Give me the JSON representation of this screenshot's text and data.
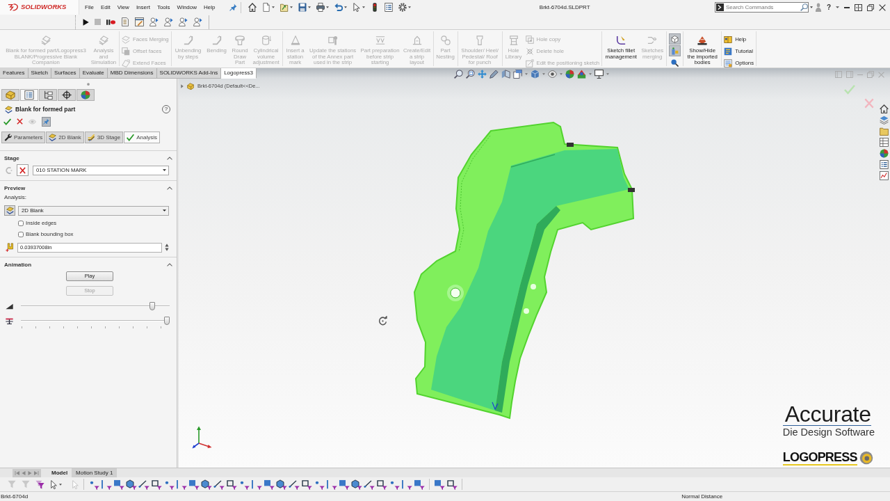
{
  "title_bar": {
    "logo": "SOLIDWORKS",
    "menus": [
      "File",
      "Edit",
      "View",
      "Insert",
      "Tools",
      "Window",
      "Help"
    ],
    "document_title": "Brkt-6704d.SLDPRT",
    "search": {
      "placeholder": "Search Commands"
    },
    "help_button": "?"
  },
  "ribbon": {
    "groups": [
      {
        "commands": [
          {
            "kind": "large",
            "label": "Blank for formed part/Logopress3 BLANK/Progressive Blank Companion",
            "disabled": true
          },
          {
            "kind": "large",
            "label": "Analysis and Simulation",
            "disabled": true
          }
        ]
      },
      {
        "commands": [
          {
            "kind": "small",
            "label": "Faces Merging",
            "disabled": true
          },
          {
            "kind": "small",
            "label": "Offset faces",
            "disabled": true
          },
          {
            "kind": "small",
            "label": "Extend Faces",
            "disabled": true
          }
        ]
      },
      {
        "commands": [
          {
            "kind": "large",
            "label": "Unbending by steps",
            "disabled": true
          },
          {
            "kind": "large",
            "label": "Bending",
            "disabled": true
          },
          {
            "kind": "large",
            "label": "Round Draw Part",
            "disabled": true
          },
          {
            "kind": "large",
            "label": "Cylindrical volume adjustment",
            "disabled": true
          }
        ]
      },
      {
        "commands": [
          {
            "kind": "large",
            "label": "Insert a station mark",
            "disabled": true
          },
          {
            "kind": "large",
            "label": "Update the stations of the Annex part used in the strip",
            "disabled": true
          },
          {
            "kind": "large",
            "label": "Part preparation before strip starting",
            "disabled": true
          },
          {
            "kind": "large",
            "label": "Create/Edit a strip layout",
            "disabled": true
          }
        ]
      },
      {
        "commands": [
          {
            "kind": "large",
            "label": "Part Nesting",
            "disabled": true
          }
        ]
      },
      {
        "commands": [
          {
            "kind": "large",
            "label": "Shoulder/ Heel/ Pedestal/ Roof for punch",
            "disabled": true
          }
        ]
      },
      {
        "commands": [
          {
            "kind": "large",
            "label": "Hole Library",
            "disabled": true
          },
          {
            "kind": "small",
            "label": "Hole copy",
            "disabled": true
          },
          {
            "kind": "small",
            "label": "Delete hole",
            "disabled": true
          },
          {
            "kind": "small",
            "label": "Edit the positioning sketch",
            "disabled": true
          }
        ]
      },
      {
        "commands": [
          {
            "kind": "large",
            "label": "Sketch fillet management",
            "disabled": false
          },
          {
            "kind": "large",
            "label": "Sketches merging",
            "disabled": true
          }
        ]
      },
      {
        "commands": [
          {
            "kind": "toggle",
            "pressed": true
          },
          {
            "kind": "toggle",
            "pressed": true
          },
          {
            "kind": "toggle",
            "pressed": false
          }
        ]
      },
      {
        "commands": [
          {
            "kind": "large",
            "label": "Show/Hide the imported bodies",
            "disabled": false
          }
        ]
      },
      {
        "commands": [
          {
            "kind": "small",
            "label": "Help",
            "disabled": false
          },
          {
            "kind": "small",
            "label": "Tutorial",
            "disabled": false
          },
          {
            "kind": "small",
            "label": "Options",
            "disabled": false
          }
        ]
      }
    ]
  },
  "command_tabs": [
    {
      "label": "Features",
      "selected": false
    },
    {
      "label": "Sketch",
      "selected": false
    },
    {
      "label": "Surfaces",
      "selected": false
    },
    {
      "label": "Evaluate",
      "selected": false
    },
    {
      "label": "MBD Dimensions",
      "selected": false
    },
    {
      "label": "SOLIDWORKS Add-Ins",
      "selected": false
    },
    {
      "label": "Logopress3",
      "selected": true
    }
  ],
  "property_manager": {
    "manager_tabs": [
      {
        "selected": false
      },
      {
        "selected": true
      },
      {
        "selected": false
      },
      {
        "selected": false
      },
      {
        "selected": false
      }
    ],
    "title": "Blank for formed part",
    "help_button": "?",
    "pinned": true,
    "tabs": [
      {
        "label": "Parameters",
        "selected": false
      },
      {
        "label": "2D Blank",
        "selected": false
      },
      {
        "label": "3D Stage",
        "selected": false
      },
      {
        "label": "Analysis",
        "selected": true
      }
    ],
    "sections": [
      {
        "kind": "stage",
        "title": "Stage",
        "expanded": true,
        "station": "010 STATION MARK"
      },
      {
        "kind": "preview",
        "title": "Preview",
        "expanded": true,
        "analysis_label": "Analysis:",
        "analysis": "2D Blank",
        "options": [
          {
            "label": "Inside edges",
            "checked": false
          },
          {
            "label": "Blank bounding box",
            "checked": false
          }
        ],
        "numeric_field": "0.03937008in"
      },
      {
        "kind": "animation",
        "title": "Animation",
        "expanded": true,
        "buttons": [
          {
            "label": "Play",
            "disabled": false
          },
          {
            "label": "Stop",
            "disabled": true
          }
        ],
        "sliders": [
          {
            "level": 0.9,
            "ticks": false
          },
          {
            "level": 1,
            "ticks": true
          }
        ]
      }
    ]
  },
  "viewport": {
    "tree_flyout": "Brkt-6704d (Default<<De...",
    "overlay_logo": {
      "brand": "Accurate",
      "tagline": "Die Design Software",
      "product": "LOGOPRESS"
    }
  },
  "bottom_tabs": [
    {
      "label": "Model",
      "selected": true
    },
    {
      "label": "Motion Study 1",
      "selected": false
    }
  ],
  "status_bar": {
    "document": "Brkt-6704d",
    "measure_mode": "Normal Distance"
  }
}
